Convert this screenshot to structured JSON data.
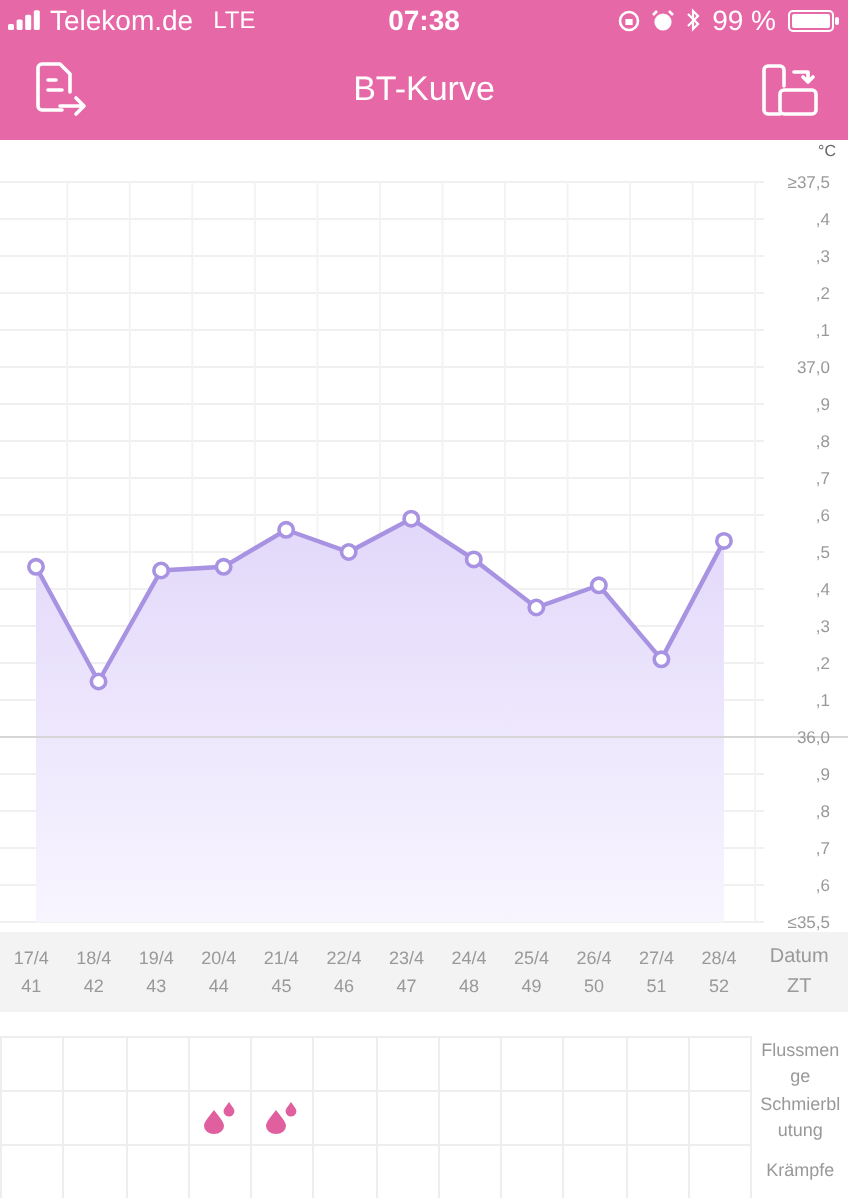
{
  "status_bar": {
    "carrier": "Telekom.de",
    "network": "LTE",
    "time": "07:38",
    "battery": "99 %"
  },
  "nav_bar": {
    "title": "BT-Kurve"
  },
  "chart": {
    "unit": "°C",
    "chart_data": {
      "type": "area",
      "categories": [
        "17/4",
        "18/4",
        "19/4",
        "20/4",
        "21/4",
        "22/4",
        "23/4",
        "24/4",
        "25/4",
        "26/4",
        "27/4",
        "28/4"
      ],
      "grid": true,
      "ref_lines": [
        {
          "axis": "y",
          "value": 36.0
        }
      ],
      "series": [
        {
          "color": "#a892e2",
          "values": [
            36.46,
            36.15,
            36.45,
            36.46,
            36.56,
            36.5,
            36.59,
            36.48,
            36.35,
            36.41,
            36.21,
            36.53
          ]
        }
      ],
      "ylim": [
        35.5,
        37.5
      ],
      "yticks": [
        {
          "value": 37.5,
          "label": "≥37,5"
        },
        {
          "value": 37.0,
          "label": "37,0"
        },
        {
          "value": 36.0,
          "label": "36,0"
        },
        {
          "value": 35.5,
          "label": "≤35,5"
        }
      ]
    },
    "minor_tick_labels": [
      ",4",
      ",3",
      ",2",
      ",1",
      ",9",
      ",8",
      ",7",
      ",6",
      ",5",
      ",4",
      ",3",
      ",2",
      ",1",
      ",9",
      ",8",
      ",7",
      ",6"
    ]
  },
  "date_row": {
    "date_label": "Datum",
    "cycle_label": "ZT",
    "cycle_days": [
      "41",
      "42",
      "43",
      "44",
      "45",
      "46",
      "47",
      "48",
      "49",
      "50",
      "51",
      "52"
    ]
  },
  "symptoms": [
    {
      "label": "Flussmenge",
      "cells": [
        {
          "marked": false
        },
        {
          "marked": false
        },
        {
          "marked": false
        },
        {
          "marked": false
        },
        {
          "marked": false
        },
        {
          "marked": false
        },
        {
          "marked": false
        },
        {
          "marked": false
        },
        {
          "marked": false
        },
        {
          "marked": false
        },
        {
          "marked": false
        },
        {
          "marked": false
        }
      ]
    },
    {
      "label": "Schmierblutung",
      "cells": [
        {
          "marked": false
        },
        {
          "marked": false
        },
        {
          "marked": false
        },
        {
          "marked": true
        },
        {
          "marked": true
        },
        {
          "marked": false
        },
        {
          "marked": false
        },
        {
          "marked": false
        },
        {
          "marked": false
        },
        {
          "marked": false
        },
        {
          "marked": false
        },
        {
          "marked": false
        }
      ]
    },
    {
      "label": "Krämpfe",
      "cells": [
        {
          "marked": false
        },
        {
          "marked": false
        },
        {
          "marked": false
        },
        {
          "marked": false
        },
        {
          "marked": false
        },
        {
          "marked": false
        },
        {
          "marked": false
        },
        {
          "marked": false
        },
        {
          "marked": false
        },
        {
          "marked": false
        },
        {
          "marked": false
        },
        {
          "marked": false
        }
      ]
    }
  ]
}
